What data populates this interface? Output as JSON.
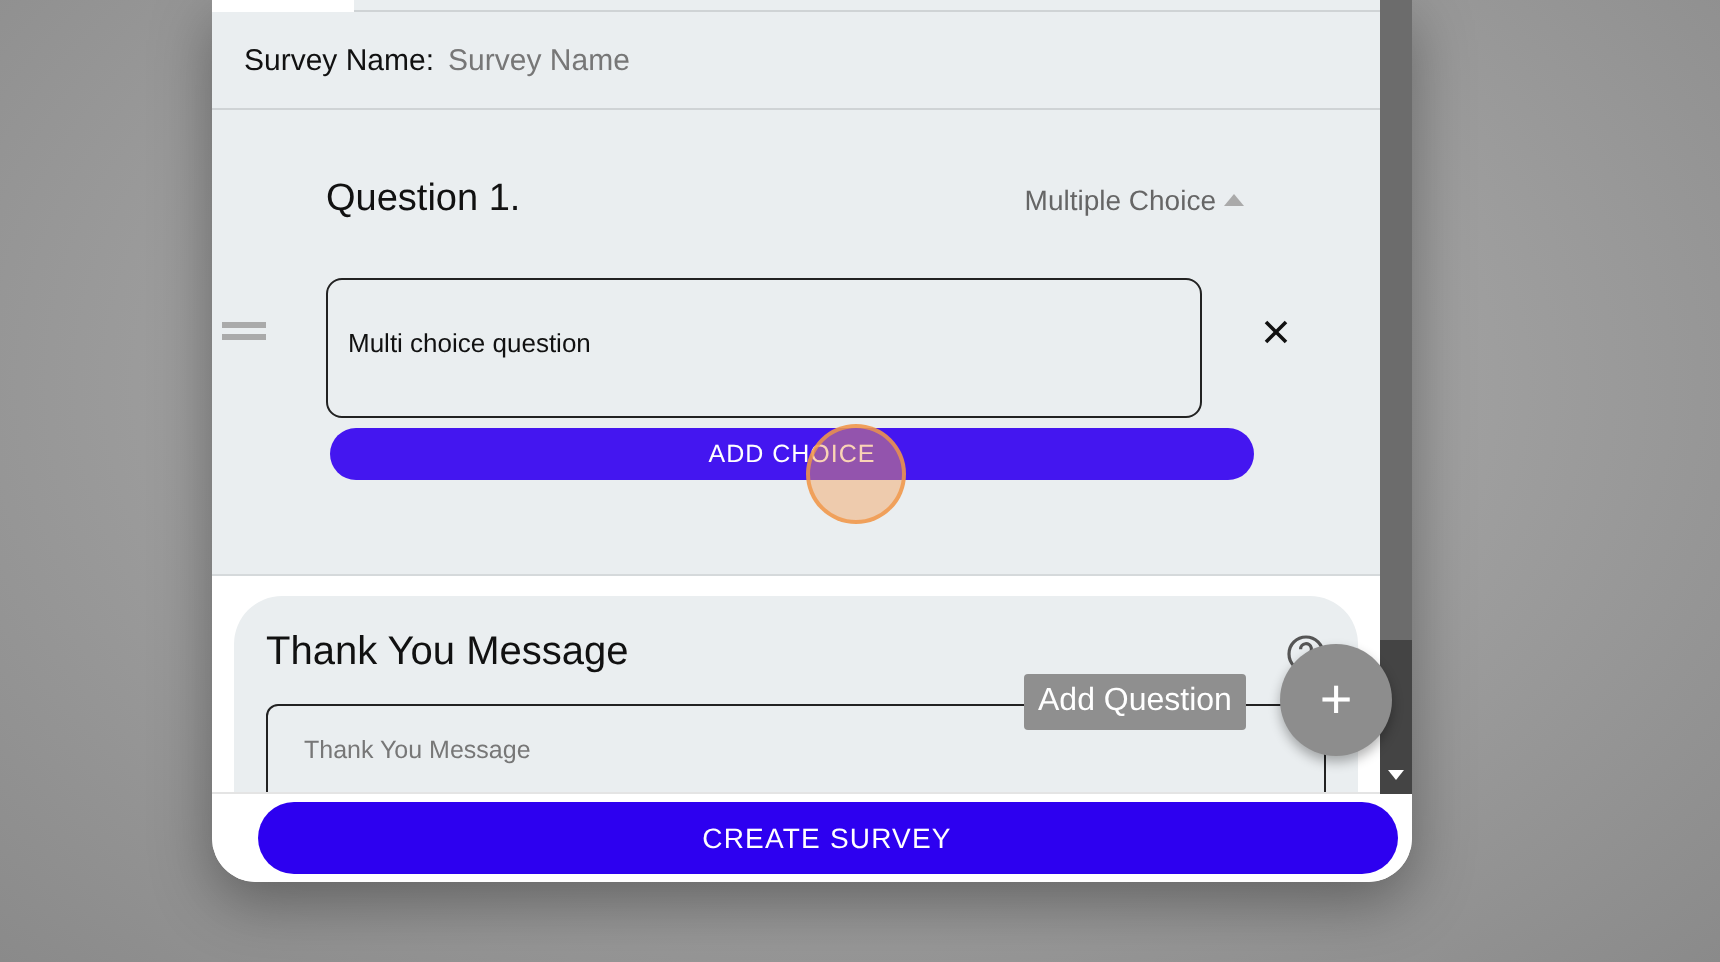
{
  "survey_name": {
    "label": "Survey Name:",
    "placeholder": "Survey Name"
  },
  "question": {
    "title": "Question 1.",
    "type": "Multiple Choice",
    "expanded": true,
    "value": "Multi choice question",
    "add_choice": "ADD CHOICE"
  },
  "thank_you": {
    "title": "Thank You Message",
    "placeholder": "Thank You Message"
  },
  "fab": {
    "tooltip": "Add Question",
    "icon": "+"
  },
  "footer": {
    "button": "CREATE SURVEY"
  }
}
